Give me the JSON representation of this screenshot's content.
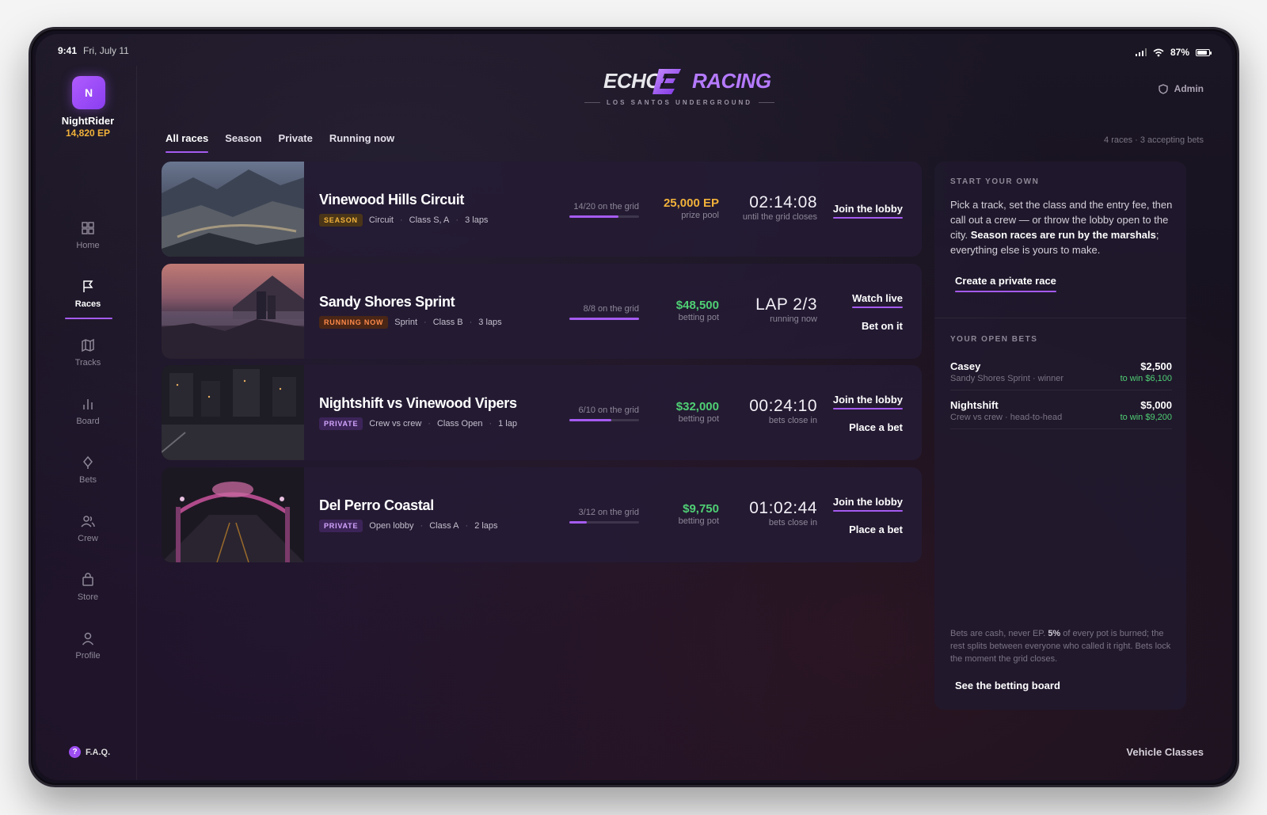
{
  "status": {
    "time": "9:41",
    "date": "Fri, July 11",
    "battery": "87%"
  },
  "user": {
    "initial": "N",
    "name": "NightRider",
    "ep": "14,820 EP"
  },
  "nav": [
    {
      "label": "Home",
      "icon": "grid-icon"
    },
    {
      "label": "Races",
      "icon": "flag-icon",
      "active": true
    },
    {
      "label": "Tracks",
      "icon": "map-icon"
    },
    {
      "label": "Board",
      "icon": "bar-chart-icon"
    },
    {
      "label": "Bets",
      "icon": "diamond-icon"
    },
    {
      "label": "Crew",
      "icon": "crew-icon"
    },
    {
      "label": "Store",
      "icon": "bag-icon"
    },
    {
      "label": "Profile",
      "icon": "person-icon"
    }
  ],
  "faq": {
    "icon_text": "?",
    "label": "F.A.Q."
  },
  "header": {
    "logo_left": "ECHO",
    "logo_right": "RACING",
    "subtitle": "LOS SANTOS UNDERGROUND",
    "admin": "Admin"
  },
  "tabs": [
    "All races",
    "Season",
    "Private",
    "Running now"
  ],
  "summary": "4 races · 3 accepting bets",
  "races": [
    {
      "title": "Vinewood Hills Circuit",
      "badge": "SEASON",
      "badge_type": "season",
      "tags": [
        "Circuit",
        "Class S, A",
        "3 laps"
      ],
      "grid": "14/20 on the grid",
      "grid_fill": 0.7,
      "pot": "25,000 EP",
      "pot_color": "#f2b23a",
      "pot_label": "prize pool",
      "time": "02:14:08",
      "time_label": "until the grid closes",
      "actions": [
        "Join the lobby"
      ]
    },
    {
      "title": "Sandy Shores Sprint",
      "badge": "RUNNING NOW",
      "badge_type": "live",
      "tags": [
        "Sprint",
        "Class B",
        "3 laps"
      ],
      "grid": "8/8 on the grid",
      "grid_fill": 1.0,
      "pot": "$48,500",
      "pot_color": "#4fcf74",
      "pot_label": "betting pot",
      "time": "LAP 2/3",
      "time_label": "running now",
      "actions": [
        "Watch live",
        "Bet on it"
      ]
    },
    {
      "title": "Nightshift vs Vinewood Vipers",
      "badge": "PRIVATE",
      "badge_type": "private",
      "tags": [
        "Crew vs crew",
        "Class Open",
        "1 lap"
      ],
      "grid": "6/10 on the grid",
      "grid_fill": 0.6,
      "pot": "$32,000",
      "pot_color": "#4fcf74",
      "pot_label": "betting pot",
      "time": "00:24:10",
      "time_label": "bets close in",
      "actions": [
        "Join the lobby",
        "Place a bet"
      ]
    },
    {
      "title": "Del Perro Coastal",
      "badge": "PRIVATE",
      "badge_type": "private",
      "tags": [
        "Open lobby",
        "Class A",
        "2 laps"
      ],
      "grid": "3/12 on the grid",
      "grid_fill": 0.25,
      "pot": "$9,750",
      "pot_color": "#4fcf74",
      "pot_label": "betting pot",
      "time": "01:02:44",
      "time_label": "bets close in",
      "actions": [
        "Join the lobby",
        "Place a bet"
      ]
    }
  ],
  "panel": {
    "start_title": "START YOUR OWN",
    "start_text_1": "Pick a track, set the class and the entry fee, then call out a crew — or throw the lobby open to the city. ",
    "start_text_bold": "Season races are run by the marshals",
    "start_text_2": "; everything else is yours to make.",
    "create_label": "Create a private race",
    "bets_title": "YOUR OPEN BETS",
    "bets": [
      {
        "name": "Casey",
        "desc": "Sandy Shores Sprint · winner",
        "amount": "$2,500",
        "win": "to win $6,100"
      },
      {
        "name": "Nightshift",
        "desc": "Crew vs crew · head-to-head",
        "amount": "$5,000",
        "win": "to win $9,200"
      }
    ],
    "foot_1": "Bets are cash, never EP. ",
    "foot_bold": "5%",
    "foot_2": " of every pot is burned; the rest splits between everyone who called it right. Bets lock the moment the grid closes.",
    "board_label": "See the betting board"
  },
  "vehicle_classes": "Vehicle Classes"
}
